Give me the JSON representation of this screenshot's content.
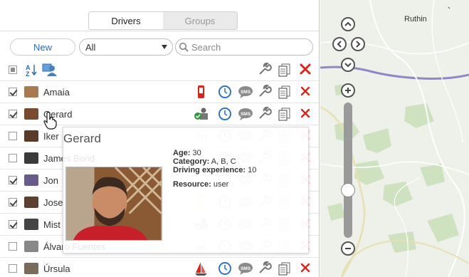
{
  "tabs": [
    {
      "label": "Drivers",
      "active": true
    },
    {
      "label": "Groups",
      "active": false
    }
  ],
  "toolbar": {
    "new_label": "New",
    "filter_value": "All",
    "search_placeholder": "Search"
  },
  "header_row": {
    "sort_icon": "sort-az-icon",
    "group_icon": "users-group-icon",
    "action_icons": [
      "wrench-icon",
      "documents-icon",
      "delete-icon"
    ]
  },
  "drivers": [
    {
      "name": "Amaia",
      "checked": true,
      "status_icon": "red-phone-icon",
      "faded": false
    },
    {
      "name": "Gerard",
      "checked": true,
      "status_icon": "driver-assigned-icon",
      "faded": false
    },
    {
      "name": "Iker",
      "checked": false,
      "status_icon": "camel-icon",
      "faded": true
    },
    {
      "name": "James Bond",
      "checked": false,
      "status_icon": "",
      "faded": true
    },
    {
      "name": "Jon",
      "checked": true,
      "status_icon": "",
      "faded": true
    },
    {
      "name": "Jose",
      "checked": true,
      "status_icon": "yellow-phone-icon",
      "faded": true
    },
    {
      "name": "Mist",
      "checked": true,
      "status_icon": "driver-assigned-icon",
      "faded": true
    },
    {
      "name": "Álvaro Fuentes",
      "checked": false,
      "status_icon": "plane-icon",
      "faded": true
    },
    {
      "name": "Úrsula",
      "checked": false,
      "status_icon": "sailboat-icon",
      "faded": false
    }
  ],
  "row_icons": [
    "clock-icon",
    "sms-icon",
    "wrench-icon",
    "documents-icon",
    "delete-icon"
  ],
  "popup": {
    "name": "Gerard",
    "age_label": "Age:",
    "age": "30",
    "category_label": "Category:",
    "category": "A, B, C",
    "experience_label": "Driving experience:",
    "experience": "10",
    "resource_label": "Resource:",
    "resource": "user"
  },
  "map": {
    "place_label": "Ruthin",
    "zoom_level": 0.75
  },
  "colors": {
    "accent_blue": "#2f6cb5",
    "delete_red": "#d9251c",
    "clock_blue": "#2f73c6"
  }
}
